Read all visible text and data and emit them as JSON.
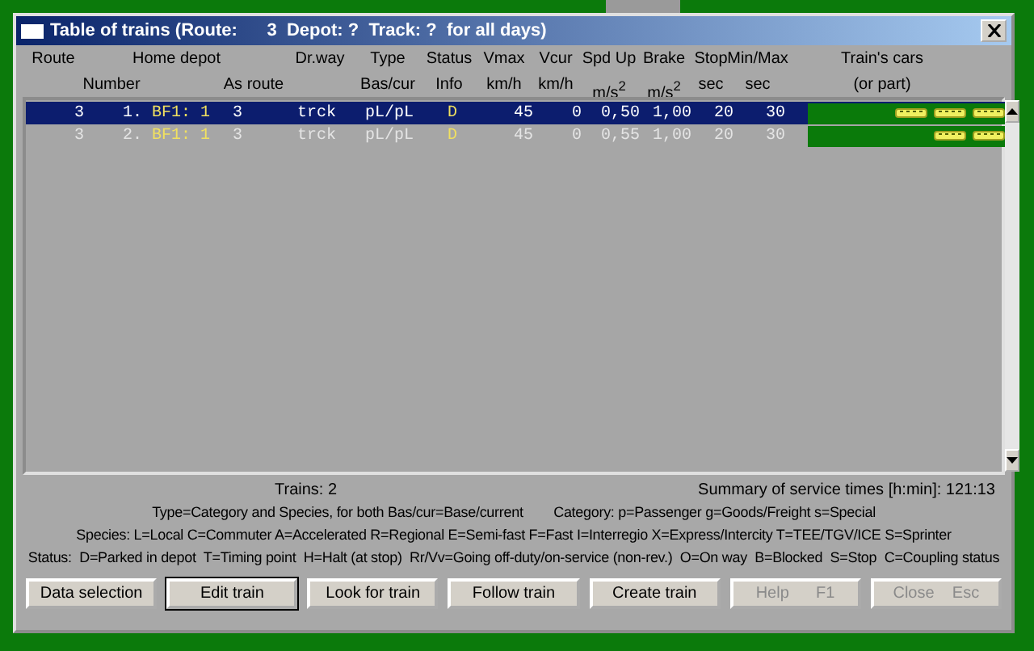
{
  "window": {
    "title": "Table of trains (Route:      3  Depot: ?  Track: ?  for all days)"
  },
  "columns": [
    {
      "top": "Route"
    },
    {
      "bottom": "Number"
    },
    {
      "top": "Home depot"
    },
    {
      "bottom": "As route"
    },
    {
      "top": "Dr.way"
    },
    {
      "top": "Type",
      "bottom": "Bas/cur"
    },
    {
      "top": "Status",
      "bottom": "Info"
    },
    {
      "top": "Vmax",
      "bottom": "km/h"
    },
    {
      "top": "Vcur",
      "bottom": "km/h"
    },
    {
      "top": "Spd Up",
      "bottom": "m/s$^{2}$"
    },
    {
      "top": "Brake",
      "bottom": "m/s$^{2}$"
    },
    {
      "top": "Stop",
      "bottom": "sec"
    },
    {
      "top": "Min/Max",
      "bottom": "sec"
    },
    {
      "top": "Train's cars",
      "bottom": "(or part)"
    }
  ],
  "rows": [
    {
      "selected": true,
      "route": "3",
      "number": "1.",
      "depot": "BF1: 1",
      "as_route": "3",
      "dr_way": "trck",
      "type": "pL/pL",
      "status": "D",
      "vmax": "45",
      "vcur": "0",
      "spd_up": "0,50",
      "brake": "1,00",
      "stop": "20",
      "min_max": "30",
      "cars": [
        {
          "kind": "coach"
        },
        {
          "kind": "coach"
        },
        {
          "kind": "coach"
        }
      ]
    },
    {
      "selected": false,
      "route": "3",
      "number": "2.",
      "depot": "BF1: 1",
      "as_route": "3",
      "dr_way": "trck",
      "type": "pL/pL",
      "status": "D",
      "vmax": "45",
      "vcur": "0",
      "spd_up": "0,55",
      "brake": "1,00",
      "stop": "20",
      "min_max": "30",
      "cars": [
        {
          "kind": "coach"
        },
        {
          "kind": "coach"
        }
      ]
    }
  ],
  "trains_count": "Trains: 2",
  "summary": "Summary of service times [h:min]: 121:13",
  "legend": [
    "Type=Category and Species, for both Bas/cur=Base/current        Category: p=Passenger g=Goods/Freight s=Special",
    "Species: L=Local C=Commuter A=Accelerated R=Regional E=Semi-fast F=Fast I=Interregio X=Express/Intercity T=TEE/TGV/ICE S=Sprinter",
    "Status:  D=Parked in depot  T=Timing point  H=Halt (at stop)  Rr/Vv=Going off-duty/on-service (non-rev.)  O=On way  B=Blocked  S=Stop  C=Coupling status"
  ],
  "buttons": [
    {
      "label": "Data selection",
      "default": false,
      "disabled": false
    },
    {
      "label": "Edit train",
      "default": true,
      "disabled": false
    },
    {
      "label": "Look for train",
      "default": false,
      "disabled": false
    },
    {
      "label": "Follow train",
      "default": false,
      "disabled": false
    },
    {
      "label": "Create train",
      "default": false,
      "disabled": false
    },
    {
      "label": "Help      F1",
      "default": false,
      "disabled": true
    },
    {
      "label": "Close    Esc",
      "default": false,
      "disabled": true
    }
  ]
}
